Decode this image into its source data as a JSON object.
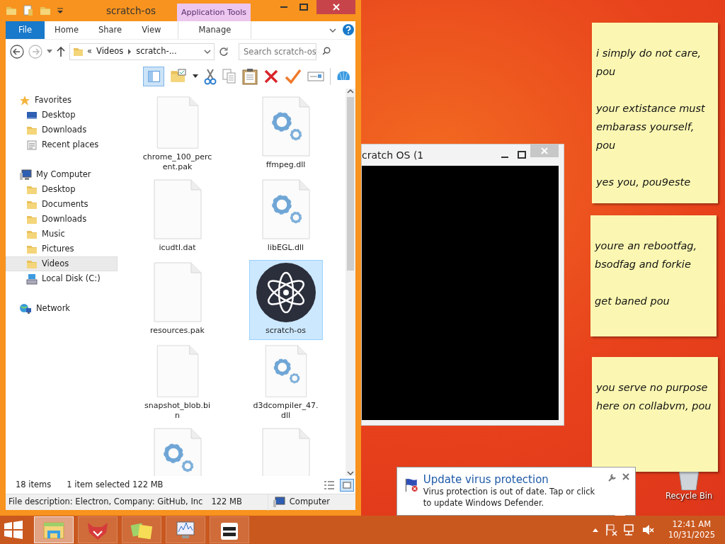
{
  "explorer": {
    "title": "scratch-os",
    "context_tab": "Application Tools",
    "ribbon_tabs": [
      {
        "label": "File",
        "kind": "file"
      },
      {
        "label": "Home",
        "kind": "tab"
      },
      {
        "label": "Share",
        "kind": "tab"
      },
      {
        "label": "View",
        "kind": "tab"
      },
      {
        "label": "Manage",
        "kind": "context"
      }
    ],
    "address": {
      "parts": [
        "«",
        "Videos",
        "scratch-..."
      ]
    },
    "search": {
      "placeholder": "Search scratch-os"
    },
    "nav": [
      {
        "label": "Favorites",
        "kind": "star",
        "selected": false,
        "children": [
          {
            "label": "Desktop",
            "kind": "desktop",
            "selected": false
          },
          {
            "label": "Downloads",
            "kind": "folder",
            "selected": false
          },
          {
            "label": "Recent places",
            "kind": "recent",
            "selected": false
          }
        ]
      },
      {
        "label": "My Computer",
        "kind": "computer",
        "selected": false,
        "children": [
          {
            "label": "Desktop",
            "kind": "folder",
            "selected": false
          },
          {
            "label": "Documents",
            "kind": "folder",
            "selected": false
          },
          {
            "label": "Downloads",
            "kind": "folder",
            "selected": false
          },
          {
            "label": "Music",
            "kind": "folder",
            "selected": false
          },
          {
            "label": "Pictures",
            "kind": "folder",
            "selected": false
          },
          {
            "label": "Videos",
            "kind": "folder",
            "selected": true
          },
          {
            "label": "Local Disk (C:)",
            "kind": "drive",
            "selected": false
          }
        ]
      },
      {
        "label": "Network",
        "kind": "network",
        "selected": false
      }
    ],
    "files": [
      {
        "name": "chrome_100_perc ent.pak",
        "kind": "blank",
        "selected": false
      },
      {
        "name": "ffmpeg.dll",
        "kind": "dll",
        "selected": false
      },
      {
        "name": "icudtl.dat",
        "kind": "blank",
        "selected": false
      },
      {
        "name": "libEGL.dll",
        "kind": "dll",
        "selected": false
      },
      {
        "name": "resources.pak",
        "kind": "blank",
        "selected": false
      },
      {
        "name": "scratch-os",
        "kind": "app",
        "selected": true
      },
      {
        "name": "snapshot_blob.bi n",
        "kind": "blank",
        "selected": false
      },
      {
        "name": "d3dcompiler_47. dll",
        "kind": "dll",
        "selected": false
      },
      {
        "kind": "dll",
        "selected": false
      },
      {
        "kind": "blank",
        "selected": false
      }
    ],
    "status": {
      "count": "18 items",
      "selection": "1 item selected  122 MB"
    },
    "details": {
      "description": "File description: Electron, Company: GitHub, Inc",
      "size": "122 MB",
      "location": "Computer"
    }
  },
  "app_window": {
    "title": "cratch OS (1"
  },
  "notes": [
    {
      "paragraphs": [
        "i simply do not care, pou",
        "your extistance must embarass yourself, pou",
        "yes you, pou9este"
      ]
    },
    {
      "paragraphs": [
        "youre an rebootfag, bsodfag and forkie",
        "get baned pou"
      ]
    },
    {
      "paragraphs": [
        "you serve no purpose here on collabvm, pou"
      ]
    }
  ],
  "recycle_bin": {
    "label": "Recycle Bin"
  },
  "toast": {
    "title": "Update virus protection",
    "body": "Virus protection is out of date. Tap or click to update Windows Defender."
  },
  "taskbar": {
    "apps": [
      {
        "kind": "explorer",
        "selected": true
      },
      {
        "kind": "fox",
        "selected": false
      },
      {
        "kind": "notes",
        "selected": false
      },
      {
        "kind": "monitor",
        "selected": false
      },
      {
        "kind": "app",
        "selected": false
      }
    ],
    "time": "12:41 AM",
    "date": "10/31/2025"
  }
}
